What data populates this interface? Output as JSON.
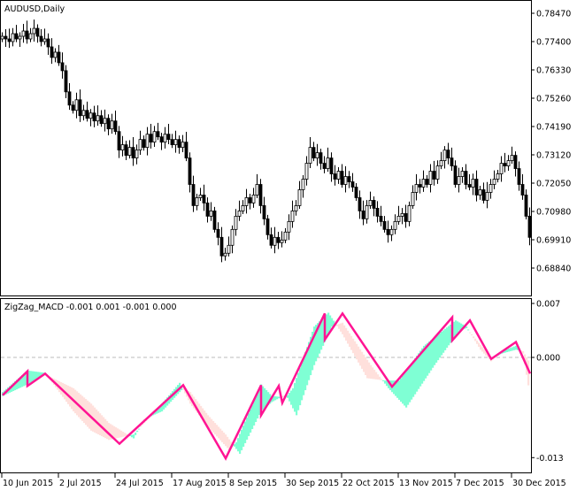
{
  "chart_data": [
    {
      "type": "candlestick",
      "title": "AUDUSD,Daily",
      "ylim": [
        0.683,
        0.789
      ],
      "yticks": [
        "0.78470",
        "0.77400",
        "0.76330",
        "0.75260",
        "0.74190",
        "0.73120",
        "0.72050",
        "0.70980",
        "0.69910",
        "0.68840"
      ],
      "closes": [
        0.776,
        0.775,
        0.774,
        0.777,
        0.775,
        0.776,
        0.778,
        0.775,
        0.777,
        0.779,
        0.776,
        0.774,
        0.775,
        0.772,
        0.768,
        0.77,
        0.766,
        0.763,
        0.755,
        0.75,
        0.748,
        0.752,
        0.746,
        0.748,
        0.745,
        0.747,
        0.744,
        0.746,
        0.743,
        0.745,
        0.741,
        0.744,
        0.74,
        0.733,
        0.735,
        0.731,
        0.734,
        0.73,
        0.733,
        0.737,
        0.734,
        0.739,
        0.736,
        0.74,
        0.738,
        0.736,
        0.739,
        0.737,
        0.735,
        0.737,
        0.734,
        0.736,
        0.73,
        0.72,
        0.712,
        0.715,
        0.716,
        0.713,
        0.708,
        0.71,
        0.703,
        0.7,
        0.693,
        0.694,
        0.697,
        0.703,
        0.708,
        0.71,
        0.712,
        0.715,
        0.713,
        0.716,
        0.72,
        0.712,
        0.707,
        0.701,
        0.697,
        0.7,
        0.698,
        0.699,
        0.702,
        0.706,
        0.71,
        0.712,
        0.718,
        0.722,
        0.728,
        0.734,
        0.73,
        0.732,
        0.728,
        0.726,
        0.73,
        0.724,
        0.722,
        0.725,
        0.72,
        0.723,
        0.721,
        0.719,
        0.715,
        0.71,
        0.707,
        0.712,
        0.714,
        0.711,
        0.708,
        0.706,
        0.703,
        0.701,
        0.703,
        0.706,
        0.708,
        0.709,
        0.706,
        0.712,
        0.717,
        0.72,
        0.719,
        0.722,
        0.72,
        0.725,
        0.722,
        0.727,
        0.729,
        0.733,
        0.73,
        0.727,
        0.72,
        0.723,
        0.725,
        0.72,
        0.719,
        0.722,
        0.716,
        0.718,
        0.714,
        0.717,
        0.72,
        0.722,
        0.724,
        0.728,
        0.727,
        0.729,
        0.731,
        0.726,
        0.72,
        0.716,
        0.708,
        0.7
      ]
    },
    {
      "type": "line",
      "title": "ZigZag_MACD -0.001 0.001 -0.001 0.000",
      "ylim": [
        -0.0135,
        0.0075
      ],
      "yticks": [
        "0.007",
        "0.000",
        "-0.013"
      ],
      "zero_line": 0,
      "colors": {
        "zigzag": "#ff1493",
        "up_fill": "#7fffd4",
        "down_fill": "#ffe0dc"
      },
      "zigzag": [
        [
          0,
          -0.0049
        ],
        [
          7,
          -0.0018
        ],
        [
          7,
          -0.0037
        ],
        [
          12,
          -0.0021
        ],
        [
          33,
          -0.0112
        ],
        [
          51,
          -0.0036
        ],
        [
          63,
          -0.0131
        ],
        [
          73,
          -0.0036
        ],
        [
          73,
          -0.0075
        ],
        [
          78,
          -0.0037
        ],
        [
          79,
          -0.0059
        ],
        [
          91,
          0.0057
        ],
        [
          91,
          0.0023
        ],
        [
          96,
          0.0057
        ],
        [
          110,
          -0.0038
        ],
        [
          127,
          0.0052
        ],
        [
          127,
          0.0022
        ],
        [
          132,
          0.0048
        ],
        [
          138,
          -0.0002
        ],
        [
          145,
          0.002
        ],
        [
          149,
          -0.0021
        ]
      ],
      "macd": [
        [
          0,
          -0.0045
        ],
        [
          7,
          -0.0017
        ],
        [
          12,
          -0.002
        ],
        [
          20,
          -0.007
        ],
        [
          25,
          -0.0095
        ],
        [
          30,
          -0.0107
        ],
        [
          37,
          -0.01
        ],
        [
          45,
          -0.006
        ],
        [
          50,
          -0.0033
        ],
        [
          53,
          -0.006
        ],
        [
          58,
          -0.009
        ],
        [
          64,
          -0.012
        ],
        [
          66,
          -0.011
        ],
        [
          73,
          -0.0035
        ],
        [
          76,
          -0.005
        ],
        [
          80,
          -0.0052
        ],
        [
          82,
          -0.004
        ],
        [
          88,
          0.004
        ],
        [
          92,
          0.0058
        ],
        [
          96,
          0.003
        ],
        [
          103,
          -0.0027
        ],
        [
          108,
          -0.003
        ],
        [
          112,
          -0.003
        ],
        [
          119,
          0.0015
        ],
        [
          128,
          0.0048
        ],
        [
          131,
          0.004
        ],
        [
          135,
          0.001
        ],
        [
          138,
          -0.0005
        ],
        [
          141,
          0.0008
        ],
        [
          145,
          0.0015
        ],
        [
          147,
          0.0005
        ],
        [
          149,
          -0.005
        ]
      ],
      "signal": [
        [
          0,
          -0.005
        ],
        [
          7,
          -0.0035
        ],
        [
          12,
          -0.0022
        ],
        [
          20,
          -0.004
        ],
        [
          25,
          -0.006
        ],
        [
          30,
          -0.0085
        ],
        [
          37,
          -0.0105
        ],
        [
          40,
          -0.008
        ],
        [
          45,
          -0.007
        ],
        [
          51,
          -0.004
        ],
        [
          53,
          -0.0045
        ],
        [
          58,
          -0.0075
        ],
        [
          63,
          -0.01
        ],
        [
          67,
          -0.0125
        ],
        [
          73,
          -0.007
        ],
        [
          76,
          -0.0058
        ],
        [
          80,
          -0.0048
        ],
        [
          83,
          -0.0075
        ],
        [
          88,
          -0.001
        ],
        [
          93,
          0.004
        ],
        [
          96,
          0.0045
        ],
        [
          104,
          -0.001
        ],
        [
          109,
          -0.004
        ],
        [
          114,
          -0.0065
        ],
        [
          122,
          -0.001
        ],
        [
          129,
          0.0035
        ],
        [
          131,
          0.0038
        ],
        [
          138,
          0.0
        ],
        [
          141,
          0.0005
        ],
        [
          145,
          0.001
        ],
        [
          147,
          0.0008
        ],
        [
          149,
          -0.0008
        ]
      ]
    }
  ],
  "x_axis_labels": [
    "10 Jun 2015",
    "2 Jul 2015",
    "24 Jul 2015",
    "17 Aug 2015",
    "8 Sep 2015",
    "30 Sep 2015",
    "22 Oct 2015",
    "13 Nov 2015",
    "7 Dec 2015",
    "30 Dec 2015"
  ],
  "x_axis_label_bars": [
    0,
    16,
    32,
    48,
    64,
    80,
    96,
    112,
    128,
    144
  ]
}
